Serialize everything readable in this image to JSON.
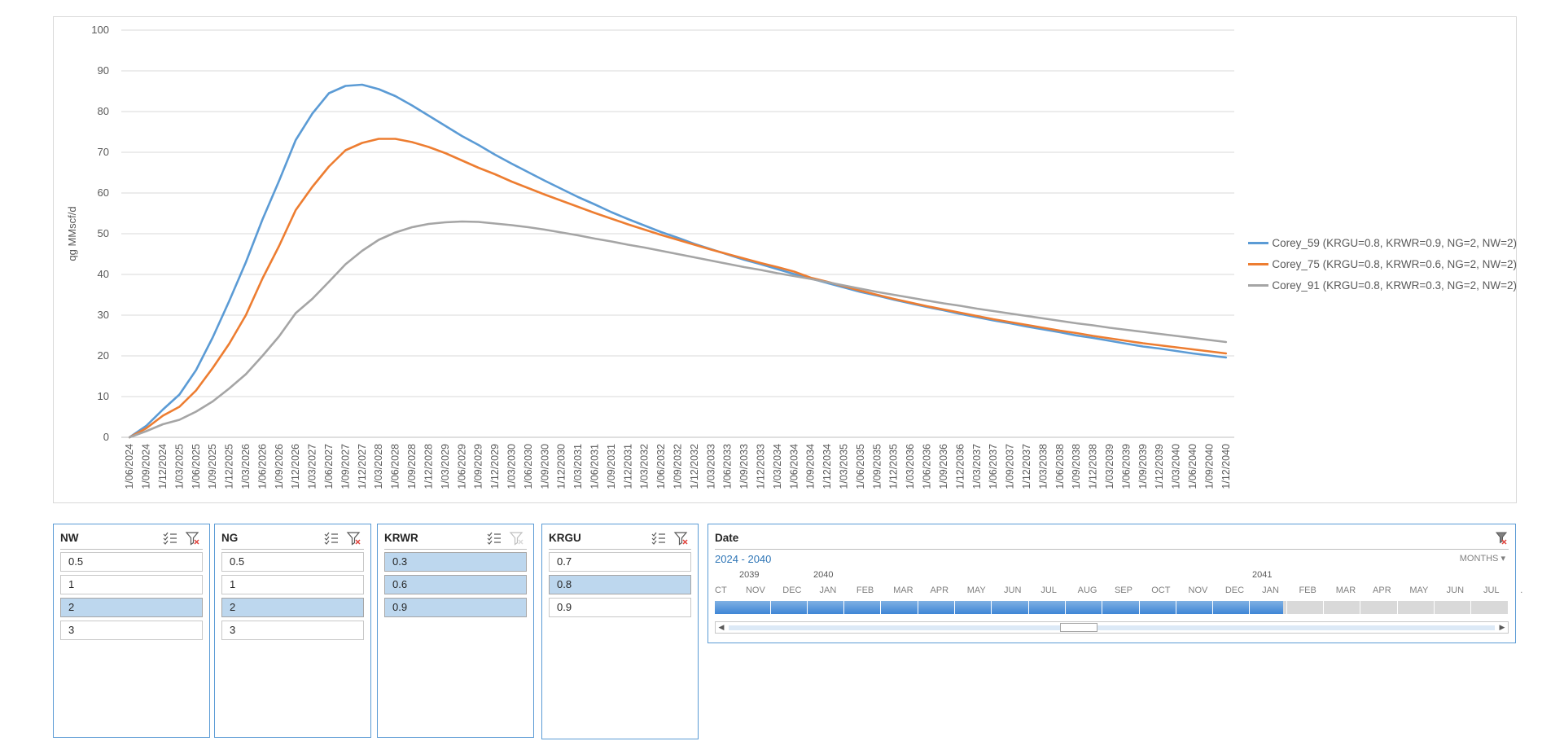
{
  "chart_data": {
    "type": "line",
    "title": "",
    "ylabel": "qg MMscf/d",
    "xlabel": "",
    "ylim": [
      0,
      100
    ],
    "yticks": [
      0,
      10,
      20,
      30,
      40,
      50,
      60,
      70,
      80,
      90,
      100
    ],
    "grid": "horizontal",
    "legend_position": "right",
    "x": [
      "1/06/2024",
      "1/09/2024",
      "1/12/2024",
      "1/03/2025",
      "1/06/2025",
      "1/09/2025",
      "1/12/2025",
      "1/03/2026",
      "1/06/2026",
      "1/09/2026",
      "1/12/2026",
      "1/03/2027",
      "1/06/2027",
      "1/09/2027",
      "1/12/2027",
      "1/03/2028",
      "1/06/2028",
      "1/09/2028",
      "1/12/2028",
      "1/03/2029",
      "1/06/2029",
      "1/09/2029",
      "1/12/2029",
      "1/03/2030",
      "1/06/2030",
      "1/09/2030",
      "1/12/2030",
      "1/03/2031",
      "1/06/2031",
      "1/09/2031",
      "1/12/2031",
      "1/03/2032",
      "1/06/2032",
      "1/09/2032",
      "1/12/2032",
      "1/03/2033",
      "1/06/2033",
      "1/09/2033",
      "1/12/2033",
      "1/03/2034",
      "1/06/2034",
      "1/09/2034",
      "1/12/2034",
      "1/03/2035",
      "1/06/2035",
      "1/09/2035",
      "1/12/2035",
      "1/03/2036",
      "1/06/2036",
      "1/09/2036",
      "1/12/2036",
      "1/03/2037",
      "1/06/2037",
      "1/09/2037",
      "1/12/2037",
      "1/03/2038",
      "1/06/2038",
      "1/09/2038",
      "1/12/2038",
      "1/03/2039",
      "1/06/2039",
      "1/09/2039",
      "1/12/2039",
      "1/03/2040",
      "1/06/2040",
      "1/09/2040",
      "1/12/2040"
    ],
    "series": [
      {
        "name": "Corey_59 (KRGU=0.8, KRWR=0.9, NG=2, NW=2)",
        "color": "#5b9bd5",
        "values": [
          0,
          2.8,
          6.8,
          10.5,
          16.5,
          24.5,
          33.5,
          43,
          53.5,
          63,
          73,
          79.5,
          84.5,
          86.3,
          86.6,
          85.5,
          83.8,
          81.5,
          79,
          76.5,
          74,
          71.8,
          69.4,
          67.2,
          65.1,
          63,
          61,
          59,
          57.2,
          55.3,
          53.6,
          52,
          50.4,
          49,
          47.5,
          46.2,
          44.9,
          43.6,
          42.5,
          41.3,
          40.1,
          39,
          37.9,
          36.8,
          35.7,
          34.8,
          33.8,
          32.9,
          32,
          31.2,
          30.3,
          29.5,
          28.7,
          28,
          27.2,
          26.5,
          25.8,
          25,
          24.4,
          23.7,
          23,
          22.3,
          21.8,
          21.2,
          20.6,
          20.1,
          19.6
        ]
      },
      {
        "name": "Corey_75 (KRGU=0.8, KRWR=0.6, NG=2, NW=2)",
        "color": "#ed7d31",
        "values": [
          0,
          2.2,
          5.3,
          7.5,
          11.5,
          17,
          23,
          30,
          39,
          47,
          55.8,
          61.5,
          66.5,
          70.5,
          72.3,
          73.3,
          73.3,
          72.5,
          71.3,
          69.8,
          68,
          66.2,
          64.6,
          62.8,
          61.2,
          59.6,
          58.1,
          56.6,
          55.1,
          53.7,
          52.3,
          51,
          49.7,
          48.5,
          47.3,
          46.1,
          45,
          43.9,
          42.8,
          41.8,
          40.7,
          39.2,
          38.2,
          37.1,
          36,
          35,
          34,
          33.1,
          32.2,
          31.4,
          30.6,
          29.8,
          29,
          28.3,
          27.6,
          26.9,
          26.2,
          25.6,
          24.9,
          24.3,
          23.7,
          23.1,
          22.6,
          22.1,
          21.6,
          21.1,
          20.6
        ]
      },
      {
        "name": "Corey_91 (KRGU=0.8, KRWR=0.3, NG=2, NW=2)",
        "color": "#a5a5a5",
        "values": [
          0,
          1.5,
          3.2,
          4.3,
          6.3,
          8.8,
          12,
          15.5,
          20,
          24.8,
          30.5,
          34,
          38.2,
          42.5,
          45.8,
          48.5,
          50.3,
          51.6,
          52.4,
          52.8,
          53,
          52.9,
          52.5,
          52.1,
          51.6,
          51,
          50.3,
          49.6,
          48.8,
          48.1,
          47.3,
          46.6,
          45.8,
          45,
          44.2,
          43.4,
          42.6,
          41.8,
          41.1,
          40.3,
          39.6,
          38.9,
          38.1,
          37.3,
          36.5,
          35.7,
          35,
          34.3,
          33.6,
          32.9,
          32.3,
          31.6,
          31,
          30.4,
          29.8,
          29.2,
          28.6,
          28,
          27.5,
          26.9,
          26.4,
          25.9,
          25.4,
          24.9,
          24.4,
          23.9,
          23.4
        ]
      }
    ]
  },
  "slicers": [
    {
      "title": "NW",
      "items": [
        {
          "label": "0.5",
          "selected": false
        },
        {
          "label": "1",
          "selected": false
        },
        {
          "label": "2",
          "selected": true
        },
        {
          "label": "3",
          "selected": false
        }
      ],
      "filter_active": true
    },
    {
      "title": "NG",
      "items": [
        {
          "label": "0.5",
          "selected": false
        },
        {
          "label": "1",
          "selected": false
        },
        {
          "label": "2",
          "selected": true
        },
        {
          "label": "3",
          "selected": false
        }
      ],
      "filter_active": true
    },
    {
      "title": "KRWR",
      "items": [
        {
          "label": "0.3",
          "selected": true
        },
        {
          "label": "0.6",
          "selected": true
        },
        {
          "label": "0.9",
          "selected": true
        }
      ],
      "filter_active": false
    },
    {
      "title": "KRGU",
      "items": [
        {
          "label": "0.7",
          "selected": false
        },
        {
          "label": "0.8",
          "selected": true
        },
        {
          "label": "0.9",
          "selected": false
        }
      ],
      "filter_active": true
    }
  ],
  "timeline": {
    "title": "Date",
    "range_label": "2024 - 2040",
    "level": "MONTHS",
    "years": [
      "2039",
      "2040",
      "2041"
    ],
    "months": [
      "CT",
      "NOV",
      "DEC",
      "JAN",
      "FEB",
      "MAR",
      "APR",
      "MAY",
      "JUN",
      "JUL",
      "AUG",
      "SEP",
      "OCT",
      "NOV",
      "DEC",
      "JAN",
      "FEB",
      "MAR",
      "APR",
      "MAY",
      "JUN",
      "JUL",
      "."
    ],
    "selected_cells": 15
  }
}
